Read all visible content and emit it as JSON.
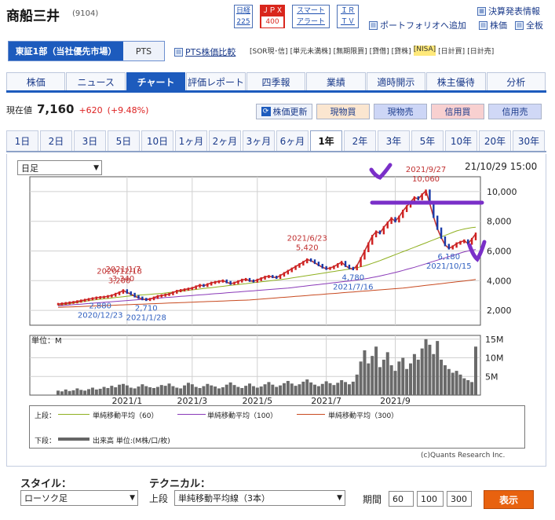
{
  "header": {
    "name": "商船三井",
    "code": "(9104)",
    "badges": [
      {
        "l1": "日経",
        "l2": "225"
      },
      {
        "l1": "ＪＰＸ",
        "l2": "400"
      },
      {
        "l1": "スマート",
        "l2": "アラート"
      },
      {
        "l1": "ＩＲ",
        "l2": "ＴＶ"
      }
    ],
    "links": [
      "決算発表情報",
      "ポートフォリオへ追加",
      "株価",
      "全板"
    ]
  },
  "market": {
    "primary": "東証1部（当社優先市場）",
    "pts": "PTS",
    "pts_compare": "PTS株価比較"
  },
  "tags": [
    "[SOR現･信]",
    "[単元未満株]",
    "[無期限買]",
    "[貸借]",
    "[貸株]",
    "[NISA]",
    "[日計買]",
    "[日計売]"
  ],
  "nav": [
    "株価",
    "ニュース",
    "チャート",
    "評価レポート",
    "四季報",
    "業績",
    "適時開示",
    "株主優待",
    "分析"
  ],
  "nav_selected": 2,
  "quote": {
    "label": "現在値",
    "price": "7,160",
    "change": "+620",
    "pct": "(+9.48%)"
  },
  "buttons": {
    "refresh": "株価更新",
    "spot_buy": "現物買",
    "spot_sell": "現物売",
    "margin_buy": "信用買",
    "margin_sell": "信用売"
  },
  "periods": [
    "1日",
    "2日",
    "3日",
    "5日",
    "10日",
    "1ヶ月",
    "2ヶ月",
    "3ヶ月",
    "6ヶ月",
    "1年",
    "2年",
    "3年",
    "5年",
    "10年",
    "20年",
    "30年"
  ],
  "period_selected": 9,
  "chart_controls": {
    "interval": "日足",
    "timestamp": "21/10/29 15:00"
  },
  "chart_data": {
    "type": "line",
    "x_ticks": [
      "2021/1",
      "2021/3",
      "2021/5",
      "2021/7",
      "2021/9"
    ],
    "y_ticks": [
      "10,000",
      "8,000",
      "6,000",
      "4,000",
      "2,000"
    ],
    "ylim": [
      1000,
      11000
    ],
    "series": [
      {
        "name": "株価",
        "color": "#c03030",
        "values": [
          2420,
          2450,
          2480,
          2520,
          2550,
          2600,
          2650,
          2700,
          2750,
          2800,
          2850,
          2880,
          2900,
          2950,
          3000,
          3100,
          3200,
          3340,
          3200,
          3100,
          2950,
          2850,
          2760,
          2710,
          2760,
          2850,
          2950,
          3000,
          3050,
          3100,
          3200,
          3300,
          3350,
          3400,
          3450,
          3500,
          3600,
          3700,
          3650,
          3750,
          3850,
          3900,
          3950,
          4000,
          3900,
          3800,
          3850,
          3950,
          4050,
          4100,
          4000,
          3950,
          4050,
          4150,
          4250,
          4300,
          4250,
          4200,
          4350,
          4500,
          4650,
          4800,
          4950,
          5100,
          5250,
          5420,
          5350,
          5200,
          5050,
          4900,
          4800,
          4850,
          4950,
          5100,
          5250,
          5000,
          4850,
          4780,
          5000,
          5500,
          6000,
          6500,
          7000,
          7300,
          7200,
          7600,
          7900,
          8200,
          8000,
          8300,
          8700,
          9000,
          9300,
          9600,
          9500,
          9800,
          10060,
          9200,
          8300,
          7500,
          6900,
          6400,
          6180,
          6300,
          6500,
          6600,
          6700,
          6500,
          6800,
          7160
        ]
      },
      {
        "name": "単純移動平均（60）",
        "color": "#8fb020",
        "values": [
          2350,
          2380,
          2410,
          2450,
          2490,
          2530,
          2570,
          2610,
          2650,
          2690,
          2720,
          2750,
          2780,
          2800,
          2830,
          2860,
          2890,
          2920,
          2950,
          2980,
          3000,
          3020,
          3040,
          3060,
          3080,
          3100,
          3120,
          3140,
          3170,
          3200,
          3230,
          3260,
          3290,
          3320,
          3350,
          3380,
          3410,
          3440,
          3470,
          3500,
          3530,
          3560,
          3590,
          3620,
          3650,
          3680,
          3710,
          3740,
          3770,
          3800,
          3830,
          3860,
          3890,
          3920,
          3950,
          3980,
          4010,
          4040,
          4070,
          4100,
          4140,
          4180,
          4220,
          4260,
          4300,
          4340,
          4380,
          4420,
          4460,
          4500,
          4540,
          4580,
          4620,
          4660,
          4700,
          4740,
          4780,
          4820,
          4870,
          4930,
          5000,
          5080,
          5170,
          5260,
          5350,
          5450,
          5550,
          5650,
          5750,
          5850,
          5950,
          6050,
          6150,
          6250,
          6350,
          6450,
          6550,
          6650,
          6750,
          6850,
          6950,
          7050,
          7150,
          7250,
          7350,
          7420,
          7480,
          7530,
          7570,
          7600
        ]
      },
      {
        "name": "単純移動平均（100）",
        "color": "#8a3ab8",
        "values": [
          2300,
          2320,
          2340,
          2360,
          2380,
          2400,
          2420,
          2440,
          2460,
          2480,
          2500,
          2520,
          2540,
          2560,
          2580,
          2600,
          2620,
          2640,
          2660,
          2680,
          2700,
          2720,
          2740,
          2760,
          2780,
          2800,
          2820,
          2840,
          2860,
          2880,
          2900,
          2920,
          2940,
          2960,
          2980,
          3000,
          3020,
          3040,
          3060,
          3080,
          3100,
          3120,
          3140,
          3160,
          3180,
          3200,
          3220,
          3240,
          3260,
          3280,
          3300,
          3320,
          3340,
          3360,
          3380,
          3400,
          3420,
          3440,
          3460,
          3480,
          3500,
          3530,
          3560,
          3590,
          3620,
          3650,
          3680,
          3710,
          3740,
          3770,
          3800,
          3830,
          3860,
          3890,
          3920,
          3950,
          3980,
          4010,
          4040,
          4080,
          4120,
          4160,
          4210,
          4260,
          4310,
          4370,
          4430,
          4490,
          4550,
          4620,
          4690,
          4760,
          4830,
          4900,
          4980,
          5060,
          5140,
          5220,
          5300,
          5380,
          5460,
          5540,
          5620,
          5700,
          5780,
          5860,
          5940,
          6000,
          6050,
          6100
        ]
      },
      {
        "name": "単純移動平均（300）",
        "color": "#c84a20",
        "values": [
          2200,
          2210,
          2220,
          2230,
          2240,
          2250,
          2260,
          2270,
          2280,
          2290,
          2300,
          2310,
          2320,
          2330,
          2340,
          2350,
          2360,
          2370,
          2380,
          2390,
          2400,
          2410,
          2420,
          2430,
          2440,
          2450,
          2460,
          2470,
          2480,
          2490,
          2500,
          2510,
          2520,
          2530,
          2540,
          2550,
          2560,
          2570,
          2580,
          2590,
          2600,
          2610,
          2620,
          2630,
          2640,
          2650,
          2660,
          2670,
          2680,
          2690,
          2700,
          2720,
          2740,
          2760,
          2780,
          2800,
          2820,
          2840,
          2860,
          2880,
          2900,
          2920,
          2940,
          2960,
          2980,
          3000,
          3020,
          3040,
          3060,
          3080,
          3100,
          3120,
          3140,
          3160,
          3180,
          3200,
          3220,
          3240,
          3260,
          3280,
          3300,
          3320,
          3340,
          3360,
          3380,
          3400,
          3420,
          3440,
          3460,
          3480,
          3500,
          3530,
          3560,
          3590,
          3620,
          3650,
          3680,
          3710,
          3740,
          3770,
          3800,
          3830,
          3860,
          3890,
          3920,
          3950,
          3980,
          4010,
          4040,
          4080
        ]
      }
    ],
    "annotations": [
      {
        "text": "2020/12/18",
        "i": 16,
        "v": 3200,
        "pos": "above",
        "color": "#c03030"
      },
      {
        "text": "3,200",
        "i": 16,
        "v": 3200,
        "pos": "above2",
        "color": "#c03030"
      },
      {
        "text": "2021/1/7",
        "i": 17,
        "v": 3340,
        "pos": "above",
        "color": "#c03030"
      },
      {
        "text": "3,340",
        "i": 17,
        "v": 3340,
        "pos": "above2",
        "color": "#c03030"
      },
      {
        "text": "2,880",
        "i": 11,
        "v": 2880,
        "pos": "below",
        "color": "#3060c0"
      },
      {
        "text": "2020/12/23",
        "i": 11,
        "v": 2880,
        "pos": "below2",
        "color": "#3060c0"
      },
      {
        "text": "2,710",
        "i": 23,
        "v": 2710,
        "pos": "below",
        "color": "#3060c0"
      },
      {
        "text": "2021/1/28",
        "i": 23,
        "v": 2710,
        "pos": "below2",
        "color": "#3060c0"
      },
      {
        "text": "2021/6/23",
        "i": 65,
        "v": 5420,
        "pos": "above",
        "color": "#c03030"
      },
      {
        "text": "5,420",
        "i": 65,
        "v": 5420,
        "pos": "above2",
        "color": "#c03030"
      },
      {
        "text": "4,780",
        "i": 77,
        "v": 4780,
        "pos": "below",
        "color": "#3060c0"
      },
      {
        "text": "2021/7/16",
        "i": 77,
        "v": 4780,
        "pos": "below2",
        "color": "#3060c0"
      },
      {
        "text": "2021/9/27",
        "i": 96,
        "v": 10060,
        "pos": "above",
        "color": "#c03030"
      },
      {
        "text": "10,060",
        "i": 96,
        "v": 10060,
        "pos": "above2",
        "color": "#c03030"
      },
      {
        "text": "6,180",
        "i": 102,
        "v": 6180,
        "pos": "below",
        "color": "#3060c0"
      },
      {
        "text": "2021/10/15",
        "i": 102,
        "v": 6180,
        "pos": "below2",
        "color": "#3060c0"
      }
    ],
    "volume": {
      "unit_label": "単位：M",
      "y_ticks": [
        "15M",
        "10M",
        "5M"
      ],
      "ylim": [
        0,
        16
      ],
      "values": [
        1.2,
        1.0,
        1.5,
        1.1,
        1.3,
        1.8,
        1.4,
        1.2,
        1.6,
        2.0,
        1.5,
        1.7,
        2.2,
        1.9,
        2.5,
        2.1,
        2.8,
        3.0,
        2.6,
        2.0,
        1.8,
        2.3,
        2.9,
        2.4,
        2.1,
        1.9,
        2.2,
        2.7,
        2.5,
        3.1,
        2.4,
        2.0,
        1.8,
        2.6,
        3.3,
        2.9,
        2.2,
        1.9,
        2.4,
        3.0,
        2.6,
        2.3,
        1.8,
        2.1,
        2.8,
        3.4,
        2.7,
        2.2,
        1.9,
        2.5,
        3.1,
        2.4,
        2.0,
        2.3,
        2.9,
        3.5,
        2.8,
        2.2,
        2.6,
        3.2,
        3.8,
        3.1,
        2.5,
        2.9,
        3.6,
        4.2,
        3.4,
        2.8,
        2.4,
        3.0,
        3.7,
        3.2,
        2.7,
        3.3,
        4.0,
        3.5,
        2.9,
        3.6,
        5.5,
        9.0,
        12.0,
        8.5,
        10.5,
        13.0,
        7.5,
        9.5,
        11.5,
        8.0,
        6.5,
        9.0,
        10.0,
        7.0,
        8.5,
        11.0,
        9.5,
        12.5,
        15.0,
        13.5,
        11.0,
        14.5,
        9.5,
        8.0,
        7.0,
        6.0,
        6.5,
        5.5,
        4.5,
        4.0,
        3.5,
        13.0
      ]
    },
    "legend": {
      "upper_label": "上段：",
      "lower_label": "下段：",
      "lower_text": "出来高 単位:(M株/口/枚)",
      "items": [
        {
          "name": "単純移動平均（60）",
          "color": "#8fb020"
        },
        {
          "name": "単純移動平均（100）",
          "color": "#8a3ab8"
        },
        {
          "name": "単純移動平均（300）",
          "color": "#c84a20"
        }
      ]
    },
    "credit": "(c)Quants Research Inc."
  },
  "bottom": {
    "style_label": "スタイル：",
    "style_value": "ローソク足",
    "tech_label": "テクニカル：",
    "upper": "上段",
    "tech_value": "単純移動平均線（3本）",
    "period_label": "期間",
    "p1": "60",
    "p2": "100",
    "p3": "300",
    "show": "表示"
  }
}
